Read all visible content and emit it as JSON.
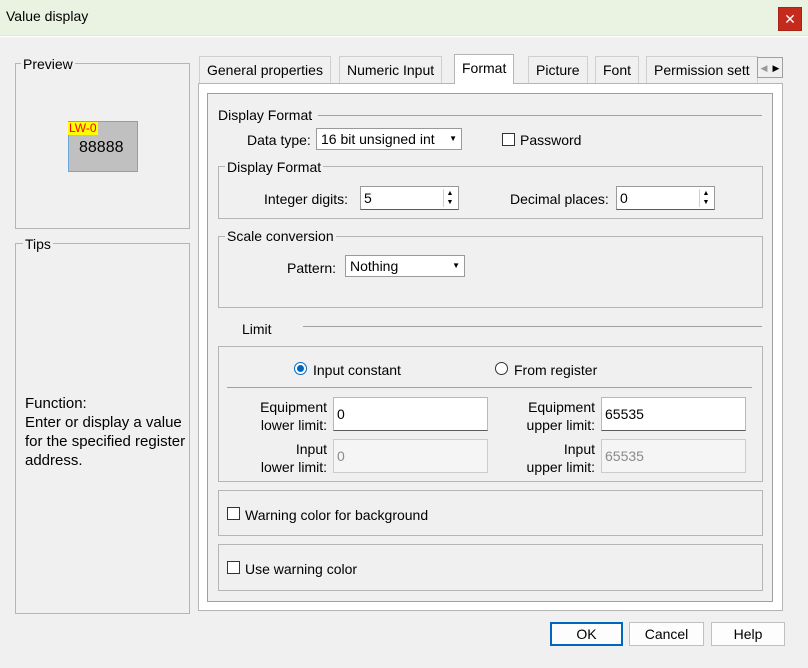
{
  "window": {
    "title": "Value display",
    "close_glyph": "✕"
  },
  "preview": {
    "label": "Preview",
    "tag": "LW-0",
    "value": "88888",
    "colors": {
      "tag_bg": "#ffff00",
      "tag_text": "#ff0000",
      "box_bg": "#c0c0c0"
    }
  },
  "tips": {
    "label": "Tips",
    "text": "Function:\nEnter or display a value for the specified register address."
  },
  "tabs": [
    {
      "label": "General properties"
    },
    {
      "label": "Numeric Input"
    },
    {
      "label": "Format",
      "active": true
    },
    {
      "label": "Picture"
    },
    {
      "label": "Font"
    },
    {
      "label": "Permission sett"
    }
  ],
  "tab_scroll": {
    "left": "◀",
    "right": "▶"
  },
  "format": {
    "display_format_label": "Display Format",
    "data_type_label": "Data type:",
    "data_type_value": "16 bit unsigned int",
    "password_label": "Password",
    "password_checked": false,
    "display_format_group_label": "Display Format",
    "integer_digits_label": "Integer digits:",
    "integer_digits_value": "5",
    "decimal_places_label": "Decimal places:",
    "decimal_places_value": "0",
    "scale_label": "Scale conversion",
    "pattern_label": "Pattern:",
    "pattern_value": "Nothing"
  },
  "limit": {
    "label": "Limit",
    "input_constant_label": "Input constant",
    "from_register_label": "From register",
    "selected": "input_constant",
    "equip_lower_label": "Equipment\nlower limit:",
    "equip_lower_value": "0",
    "equip_upper_label": "Equipment\nupper limit:",
    "equip_upper_value": "65535",
    "input_lower_label": "Input\nlower limit:",
    "input_lower_value": "0",
    "input_upper_label": "Input\nupper limit:",
    "input_upper_value": "65535"
  },
  "warnings": {
    "bg_label": "Warning color for background",
    "bg_checked": false,
    "use_label": "Use warning color",
    "use_checked": false
  },
  "buttons": {
    "ok": "OK",
    "cancel": "Cancel",
    "help": "Help"
  },
  "icons": {
    "dropdown": "▼",
    "spin_up": "▲",
    "spin_down": "▼"
  }
}
